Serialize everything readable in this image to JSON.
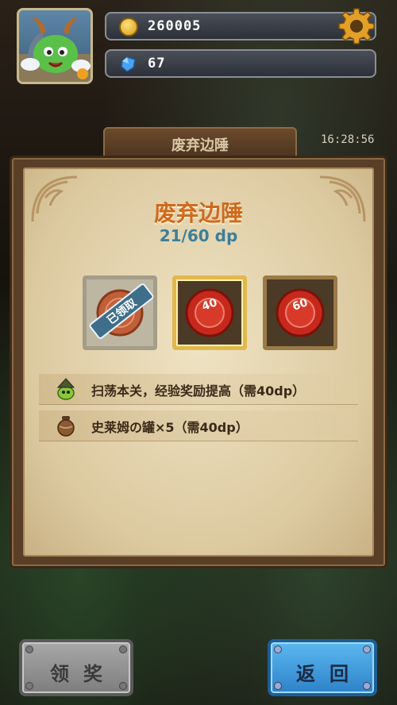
{
  "header": {
    "coins": "260005",
    "gems": "67",
    "coin_icon": "gold-coin-icon",
    "gem_icon": "blue-gem-icon",
    "settings_icon": "gear-icon"
  },
  "map": {
    "title": "废弃边陲",
    "timer": "16:28:56"
  },
  "panel": {
    "title": "废弃边陲",
    "progress": "21/60 dp",
    "chests": [
      {
        "state": "claimed",
        "label": "已领取"
      },
      {
        "state": "available",
        "label": "40"
      },
      {
        "state": "locked",
        "label": "60"
      }
    ],
    "rewards": [
      {
        "icon": "witch-slime-icon",
        "text": "扫荡本关，经验奖励提高（需40dp）"
      },
      {
        "icon": "clay-jar-icon",
        "text": "史莱姆の罐×5（需40dp）"
      }
    ]
  },
  "buttons": {
    "claim": "领奖",
    "back": "返回"
  },
  "colors": {
    "title": "#d0691e",
    "progress": "#3c7f9a",
    "back_button": "#3a9ae0",
    "claim_button": "#999999"
  }
}
